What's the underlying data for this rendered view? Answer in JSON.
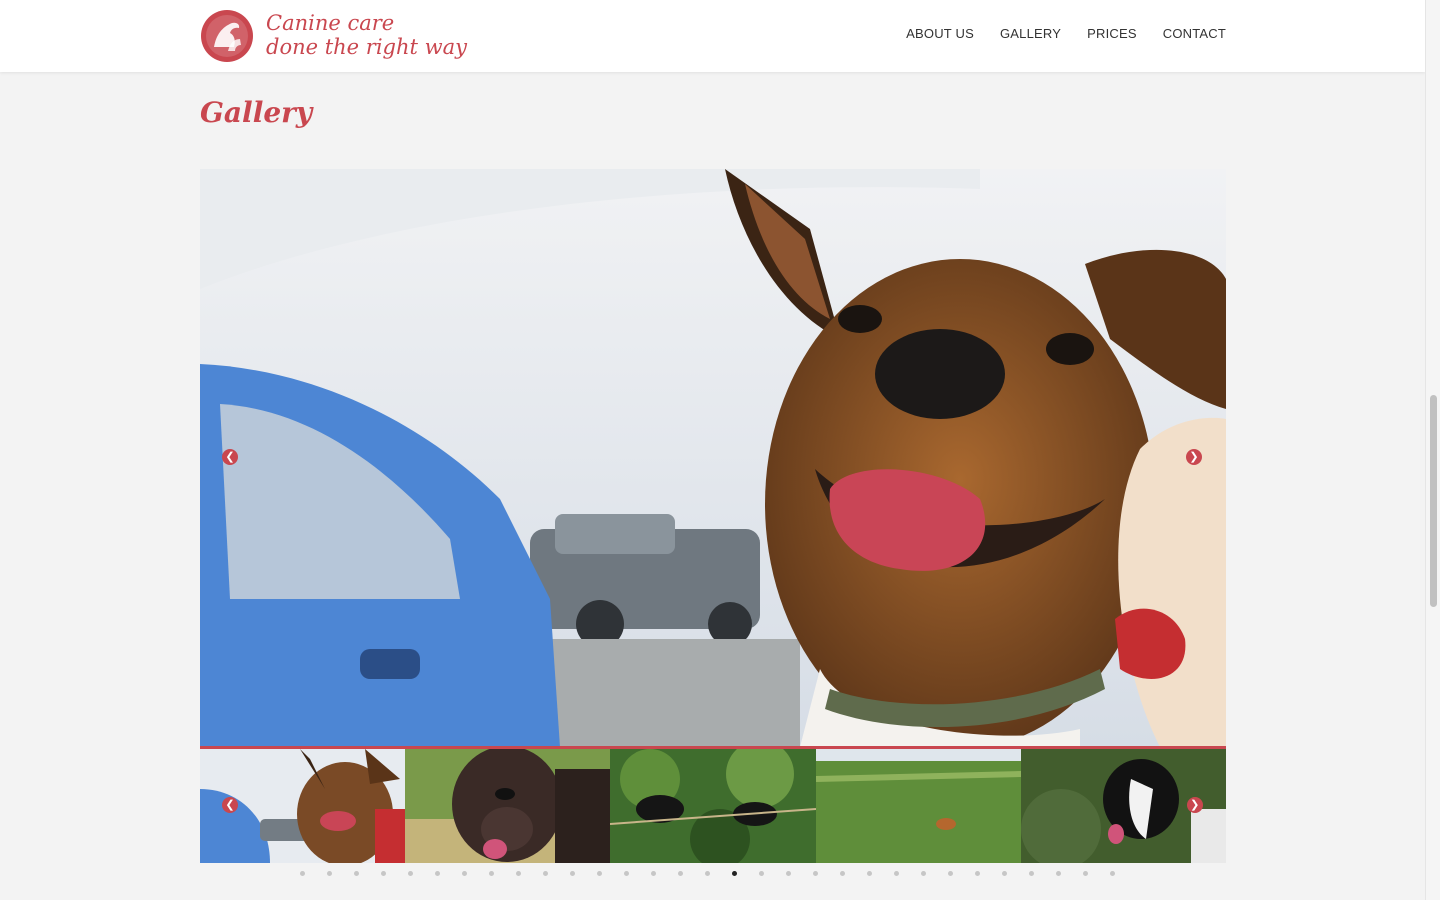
{
  "brand": {
    "line1": "Canine care",
    "line2": "done the right way",
    "color": "#c9474f",
    "logo_icon": "dog-silhouette-icon"
  },
  "nav": {
    "items": [
      "ABOUT US",
      "GALLERY",
      "PRICES",
      "CONTACT"
    ]
  },
  "page": {
    "title": "Gallery"
  },
  "slider": {
    "prev_icon": "chevron-left-icon",
    "next_icon": "chevron-right-icon",
    "thumbnails": [
      "jack-russell-car",
      "staffie-portrait",
      "black-dog-woods",
      "dog-in-field",
      "border-collie-grass"
    ],
    "dot_count": 31,
    "active_dot_index": 16
  }
}
